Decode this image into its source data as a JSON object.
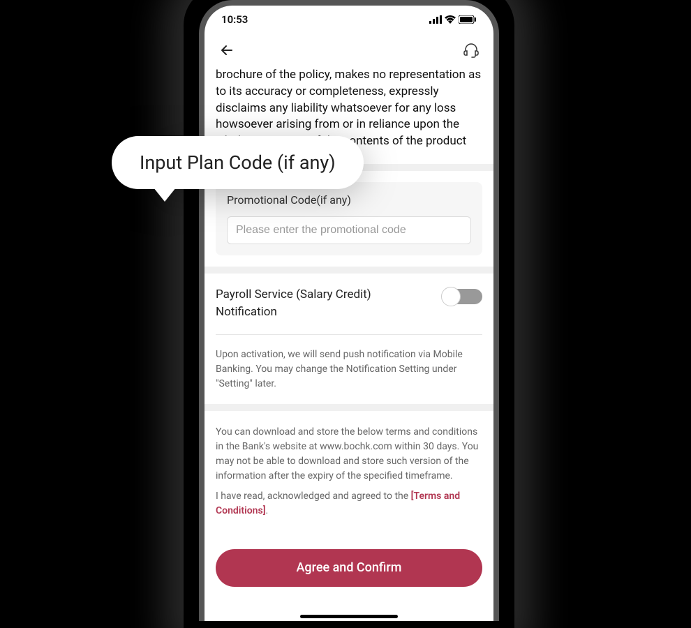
{
  "statusBar": {
    "time": "10:53"
  },
  "disclaimer": "brochure of the policy, makes no representation as to its accuracy or completeness, expressly disclaims any liability whatsoever for any loss howsoever arising from or in reliance upon the whole or any part of the contents of the product",
  "promo": {
    "label": "Promotional Code(if any)",
    "placeholder": "Please enter the promotional code"
  },
  "payroll": {
    "title": "Payroll Service (Salary Credit) Notification",
    "description": "Upon activation, we will send push notification via Mobile Banking. You may change the Notification Setting under \"Setting\" later."
  },
  "terms": {
    "download": "You can download and store the below terms and conditions in the Bank's website at www.bochk.com within 30 days. You may not be able to download and store such version of the information after the expiry of the specified timeframe.",
    "ackPrefix": "I have read, acknowledged and agreed to the ",
    "linkText": "[Terms and Conditions]",
    "ackSuffix": "."
  },
  "confirmButton": "Agree and Confirm",
  "callout": "Input Plan Code (if any)"
}
